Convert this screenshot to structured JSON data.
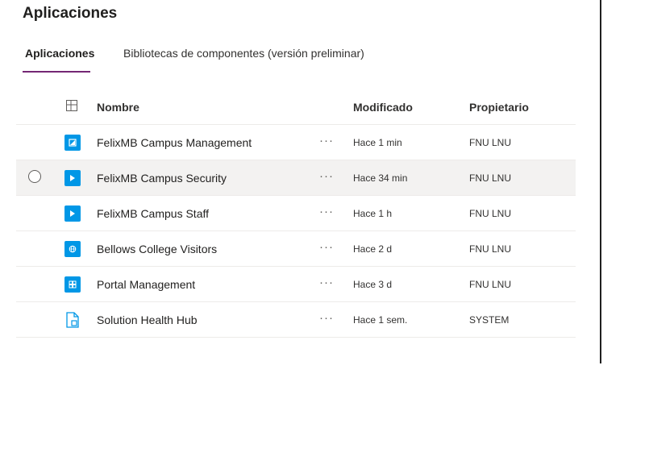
{
  "header": {
    "title": "Aplicaciones"
  },
  "tabs": [
    {
      "label": "Aplicaciones"
    },
    {
      "label": "Bibliotecas de componentes (versión preliminar)"
    }
  ],
  "table": {
    "columns": {
      "name": "Nombre",
      "modified": "Modificado",
      "owner": "Propietario"
    },
    "rows": [
      {
        "name": "FelixMB Campus Management",
        "more": "···",
        "modified": "Hace 1 min",
        "owner": "FNU LNU",
        "icon": "model-app-icon"
      },
      {
        "name": "FelixMB Campus Security",
        "more": "···",
        "modified": "Hace 34 min",
        "owner": "FNU LNU",
        "icon": "canvas-app-icon"
      },
      {
        "name": "FelixMB Campus Staff",
        "more": "···",
        "modified": "Hace 1 h",
        "owner": "FNU LNU",
        "icon": "canvas-app-icon"
      },
      {
        "name": "Bellows College Visitors",
        "more": "···",
        "modified": "Hace 2 d",
        "owner": "FNU LNU",
        "icon": "globe-app-icon"
      },
      {
        "name": "Portal Management",
        "more": "···",
        "modified": "Hace 3 d",
        "owner": "FNU LNU",
        "icon": "grid-app-icon"
      },
      {
        "name": "Solution Health Hub",
        "more": "···",
        "modified": "Hace 1 sem.",
        "owner": "SYSTEM",
        "icon": "document-app-icon"
      }
    ]
  },
  "colors": {
    "accent": "#742774",
    "app_icon": "#0097e6",
    "selected_row": "#f3f2f1"
  }
}
